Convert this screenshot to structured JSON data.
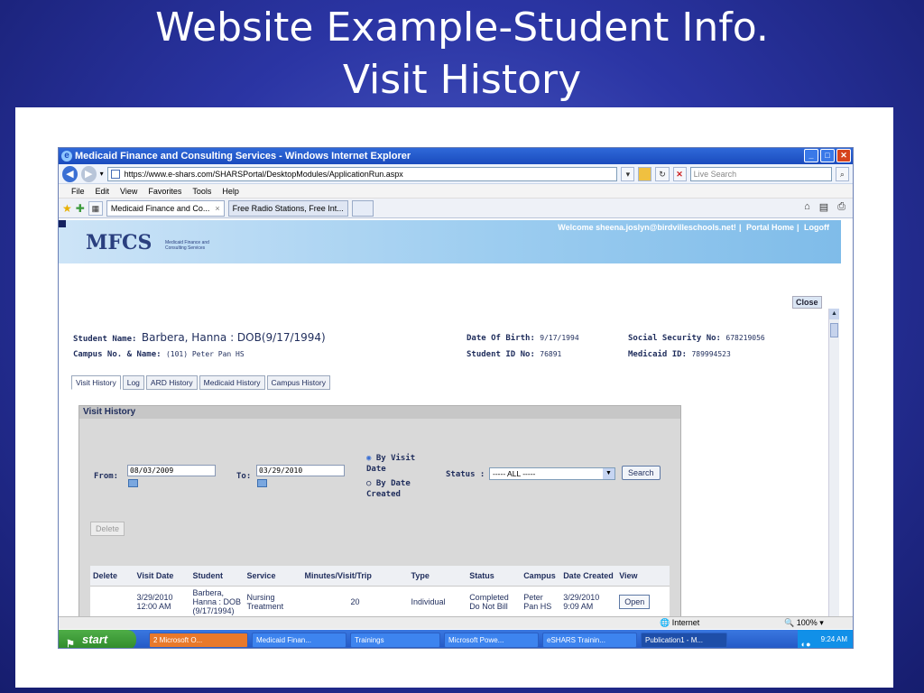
{
  "slide": {
    "title_line1": "Website Example-Student Info.",
    "title_line2": "Visit History"
  },
  "browser": {
    "window_title": "Medicaid Finance and Consulting Services - Windows Internet Explorer",
    "url": "https://www.e-shars.com/SHARSPortal/DesktopModules/ApplicationRun.aspx",
    "search_placeholder": "Live Search",
    "menu": [
      "File",
      "Edit",
      "View",
      "Favorites",
      "Tools",
      "Help"
    ],
    "tabs": [
      {
        "label": "Medicaid Finance and Co...",
        "close": "×"
      },
      {
        "label": "Free Radio Stations, Free Int..."
      }
    ],
    "status_zone": "Internet",
    "zoom": "100%"
  },
  "site": {
    "logo": "MFCS",
    "logo_sub": "Medicaid Finance and Consulting Services",
    "welcome": "Welcome sheena.joslyn@birdvilleschools.net!",
    "portal_home": "Portal Home",
    "logoff": "Logoff",
    "close_label": "Close"
  },
  "student": {
    "name_label": "Student Name:",
    "name_value": "Barbera, Hanna   : DOB(9/17/1994)",
    "campus_label": "Campus No. & Name:",
    "campus_value": "(101) Peter Pan HS",
    "dob_label": "Date Of Birth:",
    "dob_value": "9/17/1994",
    "student_id_label": "Student ID No:",
    "student_id_value": "76891",
    "ssn_label": "Social Security No:",
    "ssn_value": "678219056",
    "medicaid_label": "Medicaid ID:",
    "medicaid_value": "789994523"
  },
  "page_tabs": [
    "Visit History",
    "Log",
    "ARD History",
    "Medicaid History",
    "Campus History"
  ],
  "visit_history": {
    "heading": "Visit History",
    "from_label": "From:",
    "from_value": "08/03/2009",
    "to_label": "To:",
    "to_value": "03/29/2010",
    "radio_visit_date": "By Visit Date",
    "radio_date_created": "By Date Created",
    "status_label": "Status :",
    "status_value": "----- ALL -----",
    "search_label": "Search",
    "delete_label": "Delete",
    "columns": [
      "Delete",
      "Visit Date",
      "Student",
      "Service",
      "Minutes/Visit/Trip",
      "Type",
      "Status",
      "Campus",
      "Date Created",
      "View"
    ],
    "rows": [
      {
        "visit_date": "3/29/2010 12:00 AM",
        "student": "Barbera, Hanna : DOB (9/17/1994)",
        "service": "Nursing Treatment",
        "minutes": "20",
        "type": "Individual",
        "status": "Completed Do Not Bill",
        "campus": "Peter Pan HS",
        "date_created": "3/29/2010 9:09 AM",
        "view": "Open"
      }
    ]
  },
  "taskbar": {
    "start": "start",
    "items": [
      "2 Microsoft O...",
      "Medicaid Finan...",
      "Trainings",
      "Microsoft Powe...",
      "eSHARS Trainin...",
      "Publication1 - M..."
    ],
    "clock": "9:24 AM"
  }
}
